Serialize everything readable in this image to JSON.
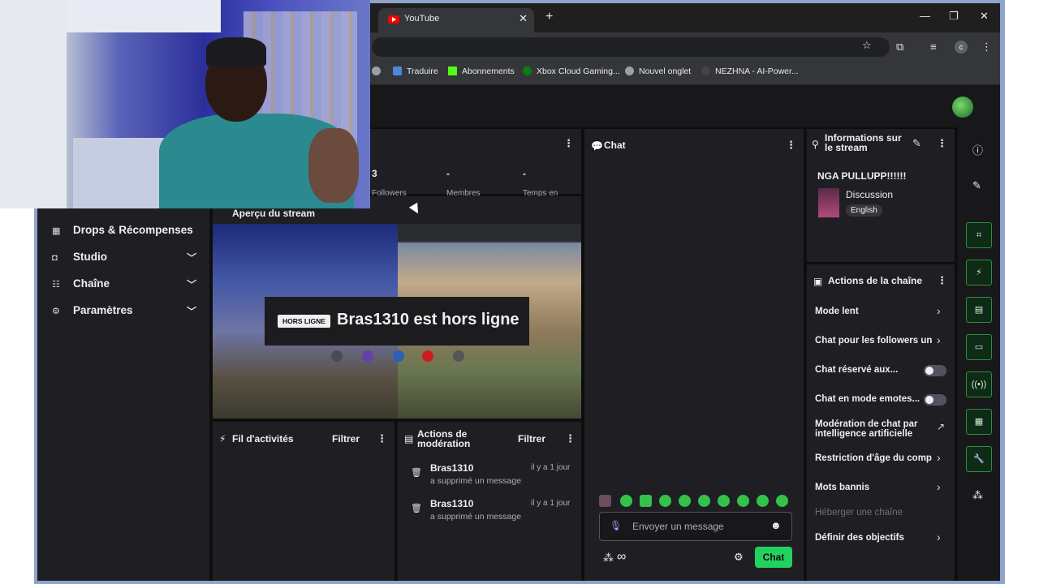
{
  "browser": {
    "tab_title": "YouTube",
    "new_tab": "+",
    "tab_close": "✕",
    "window_min": "—",
    "window_restore": "❐",
    "window_close": "✕",
    "profile_initial": "c",
    "bookmarks": [
      "Traduire",
      "Abonnements",
      "Xbox Cloud Gaming...",
      "Nouvel onglet",
      "NEZHNA - AI-Power..."
    ]
  },
  "sidebar": {
    "items": [
      {
        "label": "Drops & Récompenses",
        "icon": "gift-icon"
      },
      {
        "label": "Studio",
        "icon": "studio-icon"
      },
      {
        "label": "Chaîne",
        "icon": "channel-icon"
      },
      {
        "label": "Paramètres",
        "icon": "gear-icon"
      }
    ]
  },
  "stats": {
    "values": [
      "3",
      "-",
      "-"
    ],
    "labels": [
      "Followers",
      "Membres",
      "Temps en"
    ]
  },
  "preview": {
    "title": "Aperçu du stream",
    "badge": "HORS LIGNE",
    "offline_text": "Bras1310 est hors ligne"
  },
  "activity": {
    "title": "Fil d'activités",
    "filter": "Filtrer"
  },
  "moderation": {
    "title": "Actions de modération",
    "filter": "Filtrer",
    "rows": [
      {
        "user": "Bras1310",
        "time": "il y a 1 jour",
        "action": "a supprimé un message"
      },
      {
        "user": "Bras1310",
        "time": "il y a 1 jour",
        "action": "a supprimé un message"
      }
    ]
  },
  "chat": {
    "title": "Chat",
    "placeholder": "Envoyer un message",
    "send_label": "Chat",
    "infinity": "∞"
  },
  "stream_info": {
    "title": "Informations sur le stream",
    "stream_title": "NGA PULLUPP!!!!!!",
    "category": "Discussion",
    "language": "English"
  },
  "channel_actions": {
    "title": "Actions de la chaîne",
    "items": [
      {
        "label": "Mode lent",
        "control": "chevron"
      },
      {
        "label": "Chat pour les followers un",
        "control": "chevron"
      },
      {
        "label": "Chat réservé aux...",
        "control": "toggle"
      },
      {
        "label": "Chat en mode emotes...",
        "control": "toggle"
      },
      {
        "label": "Modération de chat par intelligence artificielle",
        "control": "external"
      },
      {
        "label": "Restriction d'âge du comp",
        "control": "chevron"
      },
      {
        "label": "Mots bannis",
        "control": "chevron"
      },
      {
        "label": "Héberger une chaîne",
        "control": "disabled"
      },
      {
        "label": "Définir des objectifs",
        "control": "chevron"
      }
    ]
  },
  "colors": {
    "accent_green": "#23d160",
    "background": "#0e0e10",
    "panel": "#1f1f23"
  }
}
